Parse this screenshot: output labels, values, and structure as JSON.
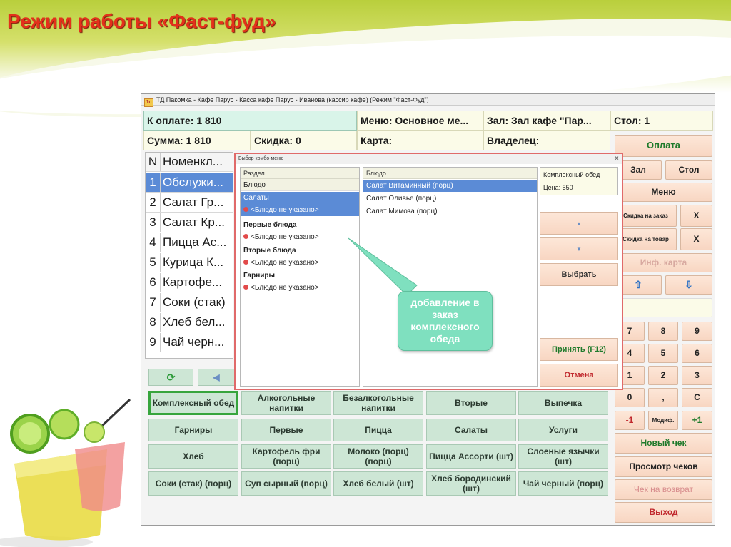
{
  "slide_title": "Режим работы «Фаст-фуд»",
  "window_title": "ТД Пакомка - Кафе Парус - Касса кафе Парус - Иванова (кассир кафе) (Режим \"Фаст-Фуд\")",
  "header": {
    "to_pay": "К оплате: 1 810",
    "menu": "Меню: Основное ме...",
    "hall": "Зал: Зал кафе \"Пар...",
    "table": "Стол: 1",
    "sum": "Сумма: 1 810",
    "discount": "Скидка: 0",
    "card": "Карта:",
    "owner": "Владелец:"
  },
  "order_table": {
    "col_n": "N",
    "col_name": "Номенкл...",
    "rows": [
      {
        "n": "1",
        "name": "Обслужи..."
      },
      {
        "n": "2",
        "name": "Салат Гр..."
      },
      {
        "n": "3",
        "name": "Салат Кр..."
      },
      {
        "n": "4",
        "name": "Пицца Ас..."
      },
      {
        "n": "5",
        "name": "Курица К..."
      },
      {
        "n": "6",
        "name": "Картофе..."
      },
      {
        "n": "7",
        "name": "Соки (стак)"
      },
      {
        "n": "8",
        "name": "Хлеб бел..."
      },
      {
        "n": "9",
        "name": "Чай черн..."
      }
    ]
  },
  "right_panel": {
    "pay": "Оплата",
    "hall": "Зал",
    "table": "Стол",
    "menu": "Меню",
    "order_discount": "Скидка на заказ",
    "item_discount": "Скидка на товар",
    "x": "X",
    "info_card": "Инф. карта",
    "up": "⇧",
    "down": "⇩",
    "keys": [
      "7",
      "8",
      "9",
      "4",
      "5",
      "6",
      "1",
      "2",
      "3",
      "0",
      ",",
      "C"
    ],
    "minus1": "-1",
    "modif": "Модиф.",
    "plus1": "+1",
    "new_check": "Новый чек",
    "view_checks": "Просмотр чеков",
    "return_check": "Чек на возврат",
    "exit": "Выход"
  },
  "categories": [
    "Комплексный обед",
    "Алкогольные напитки",
    "Безалкогольные напитки",
    "Вторые",
    "Выпечка",
    "Гарниры",
    "Первые",
    "Пицца",
    "Салаты",
    "Услуги",
    "Хлеб",
    "Картофель фри (порц)",
    "Молоко (порц) (порц)",
    "Пицца Ассорти (шт)",
    "Слоеные язычки (шт)",
    "Соки (стак) (порц)",
    "Суп сырный (порц)",
    "Хлеб белый (шт)",
    "Хлеб бородинский (шт)",
    "Чай черный (порц)"
  ],
  "nav": {
    "refresh": "⟳",
    "left": "◀"
  },
  "dialog": {
    "title": "Выбор комбо-меню",
    "close": "×",
    "section_header": "Раздел",
    "dish_col": "Блюдо",
    "groups": [
      {
        "name": "Салаты",
        "item": "<Блюдо не указано>"
      },
      {
        "name": "Первые блюда",
        "item": "<Блюдо не указано>"
      },
      {
        "name": "Вторые блюда",
        "item": "<Блюдо не указано>"
      },
      {
        "name": "Гарниры",
        "item": "<Блюдо не указано>"
      }
    ],
    "dish_header": "Блюдо",
    "dishes": [
      "Салат Витаминный (порц)",
      "Салат Оливье (порц)",
      "Салат Мимоза (порц)"
    ],
    "combo_title": "Комплексный обед",
    "price": "Цена: 550",
    "up": "▲",
    "down": "▼",
    "choose": "Выбрать",
    "accept": "Принять (F12)",
    "cancel": "Отмена"
  },
  "callout": "добавление в заказ комплексного обеда"
}
